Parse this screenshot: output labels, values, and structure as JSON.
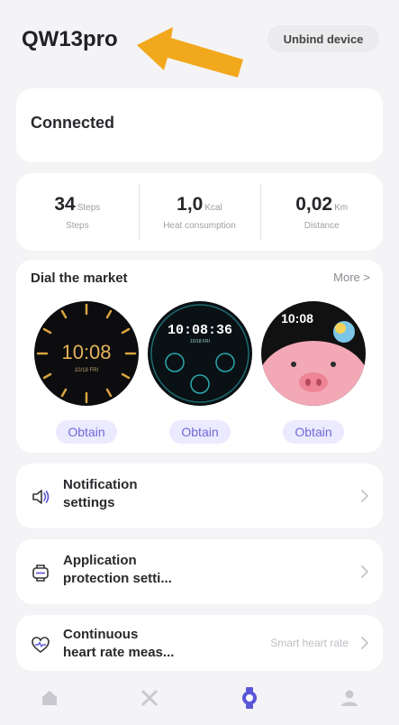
{
  "header": {
    "device_name": "QW13pro",
    "unbind_label": "Unbind device"
  },
  "status": {
    "text": "Connected"
  },
  "stats": [
    {
      "value": "34",
      "unit": "Steps",
      "label": "Steps"
    },
    {
      "value": "1,0",
      "unit": "Kcal",
      "label": "Heat consumption"
    },
    {
      "value": "0,02",
      "unit": "Km",
      "label": "Distance"
    }
  ],
  "dial_market": {
    "title": "Dial the market",
    "more_label": "More >",
    "faces": [
      {
        "time": "10:08",
        "sub": "10/18  FRI",
        "button_label": "Obtain"
      },
      {
        "time": "10:08:36",
        "sub": "10/18  FRI",
        "button_label": "Obtain"
      },
      {
        "time": "10:08",
        "sub": "",
        "button_label": "Obtain"
      }
    ]
  },
  "settings": [
    {
      "icon": "speaker-icon",
      "label_line1": "Notification",
      "label_line2": "settings",
      "value": ""
    },
    {
      "icon": "watch-shield-icon",
      "label_line1": "Application",
      "label_line2": "protection setti...",
      "value": ""
    },
    {
      "icon": "heart-pulse-icon",
      "label_line1": "Continuous",
      "label_line2": "heart rate meas...",
      "value": "Smart heart rate"
    }
  ],
  "tabbar": {
    "tabs": [
      "home-icon",
      "activity-icon",
      "watch-icon",
      "profile-icon"
    ],
    "active_index": 2
  },
  "colors": {
    "accent": "#5b57d9",
    "annotation_arrow": "#f2a81d"
  }
}
